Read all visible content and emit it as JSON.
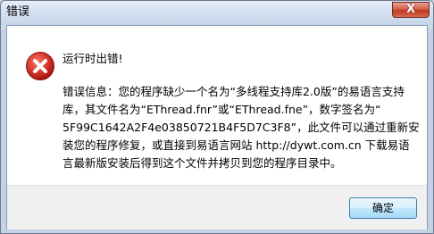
{
  "window": {
    "title": "错误",
    "close_label": "X"
  },
  "dialog": {
    "icon": "error-icon",
    "heading": "运行时出错!",
    "message_lines": [
      "错误信息：您的程序缺少一个名为“多线程支持库2.0版”的易语言支持",
      "库，其文件名为“EThread.fnr”或“EThread.fne”，数字签名为“",
      "5F99C1642A2F4e03850721B4F5D7C3F8”，此文件可以通过重新安",
      "装您的程序修复，或直接到易语言网站 http://dywt.com.cn 下载易语",
      "言最新版安装后得到这个文件并拷贝到您的程序目录中。"
    ]
  },
  "buttons": {
    "ok_label": "确定"
  },
  "colors": {
    "error_red": "#cc2a22",
    "button_border": "#3c7fb1"
  }
}
